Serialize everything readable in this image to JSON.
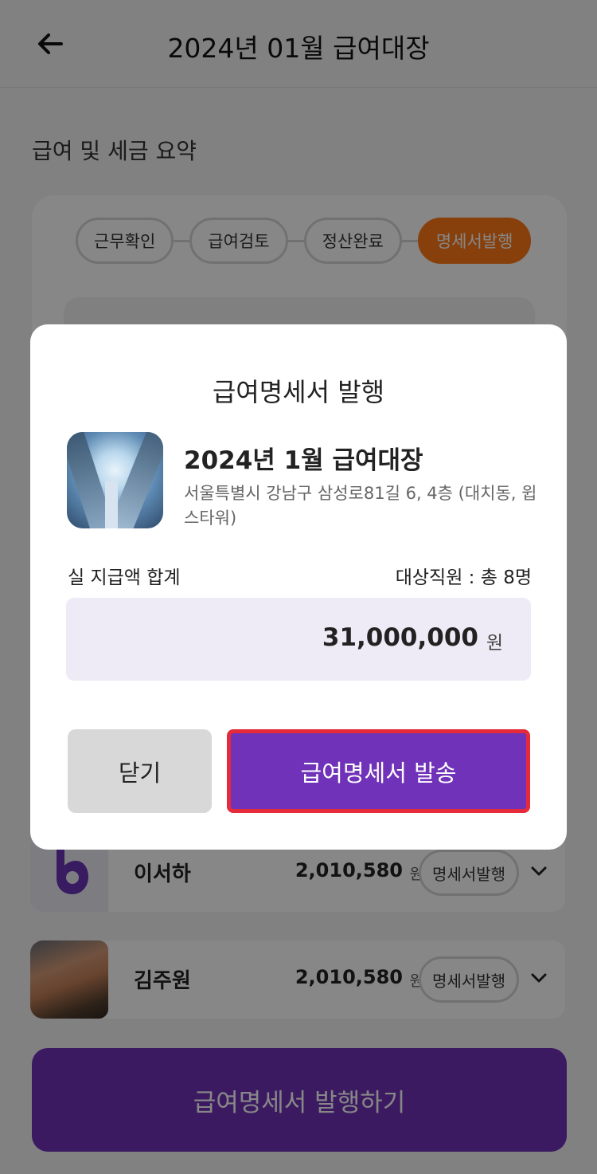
{
  "header": {
    "title": "2024년 01월 급여대장",
    "back_icon": "arrow-left-icon"
  },
  "summary": {
    "section_title": "급여 및 세금 요약",
    "steps": [
      {
        "label": "근무확인",
        "active": false
      },
      {
        "label": "급여검토",
        "active": false
      },
      {
        "label": "정산완료",
        "active": false
      },
      {
        "label": "명세서발행",
        "active": true
      }
    ]
  },
  "employees": [
    {
      "name": "이서하",
      "amount": "2,010,580",
      "unit": "원",
      "action_label": "명세서발행",
      "avatar": "brand-logo"
    },
    {
      "name": "김주원",
      "amount": "2,010,580",
      "unit": "원",
      "action_label": "명세서발행",
      "avatar": "photo"
    }
  ],
  "main_cta": {
    "label": "급여명세서 발행하기"
  },
  "modal": {
    "title": "급여명세서 발행",
    "doc_title": "2024년 1월 급여대장",
    "address": "서울특별시 강남구 삼성로81길 6, 4층 (대치동, 윕스타워)",
    "total_label": "실 지급액 합계",
    "target_label": "대상직원 : 총 8명",
    "amount": "31,000,000",
    "amount_unit": "원",
    "close_label": "닫기",
    "send_label": "급여명세서 발송"
  },
  "colors": {
    "primary": "#7032b8",
    "accent": "#ff7a16",
    "highlight_border": "#e52b3a"
  }
}
